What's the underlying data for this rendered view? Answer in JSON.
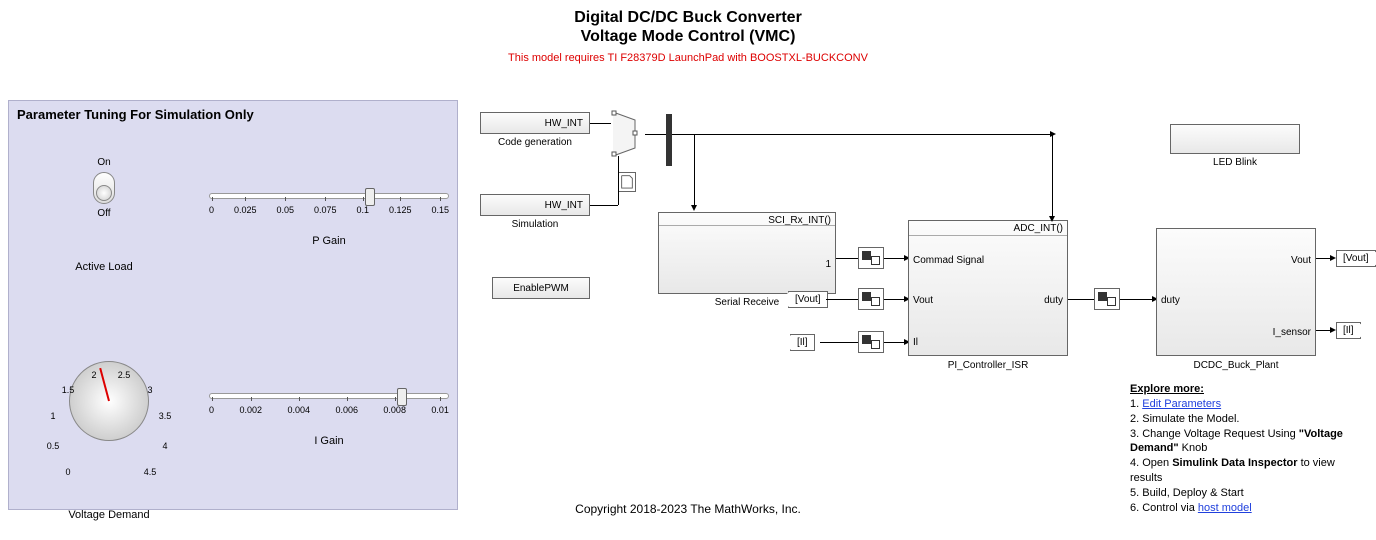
{
  "header": {
    "title1": "Digital DC/DC Buck Converter",
    "title2": "Voltage Mode Control (VMC)",
    "subtitle": "This model requires TI F28379D LaunchPad with BOOSTXL-BUCKCONV"
  },
  "copyright": "Copyright 2018-2023 The MathWorks, Inc.",
  "panel": {
    "title": "Parameter Tuning For Simulation Only",
    "active_load": {
      "label": "Active Load",
      "on": "On",
      "off": "Off",
      "state": "Off"
    },
    "p_gain": {
      "label": "P Gain",
      "ticks": [
        "0",
        "0.025",
        "0.05",
        "0.075",
        "0.1",
        "0.125",
        "0.15"
      ],
      "value": 0.1,
      "min": 0,
      "max": 0.15
    },
    "i_gain": {
      "label": "I Gain",
      "ticks": [
        "0",
        "0.002",
        "0.004",
        "0.006",
        "0.008",
        "0.01"
      ],
      "value": 0.008,
      "min": 0,
      "max": 0.01
    },
    "voltage_demand": {
      "label": "Voltage Demand",
      "ticks": [
        "0",
        "0.5",
        "1",
        "1.5",
        "2",
        "2.5",
        "3",
        "3.5",
        "4",
        "4.5"
      ],
      "value": 2,
      "min": 0,
      "max": 4.5
    }
  },
  "blocks": {
    "hw_int_1": "HW_INT",
    "hw_int_1_cap": "Code generation",
    "hw_int_2": "HW_INT",
    "hw_int_2_cap": "Simulation",
    "enable_pwm": "EnablePWM",
    "serial_rx_hdr": "SCI_Rx_INT()",
    "serial_rx_port": "1",
    "serial_rx_cap": "Serial Receive",
    "pi_hdr": "ADC_INT()",
    "pi_in1": "Commad Signal",
    "pi_in2": "Vout",
    "pi_in3": "Il",
    "pi_out": "duty",
    "pi_cap": "PI_Controller_ISR",
    "plant_in": "duty",
    "plant_out1": "Vout",
    "plant_out2": "I_sensor",
    "plant_cap": "DCDC_Buck_Plant",
    "led_cap": "LED Blink",
    "tag_vout": "[Vout]",
    "tag_il": "[Il]",
    "goto_vout": "[Vout]",
    "goto_il": "[Il]"
  },
  "explore": {
    "hd": "Explore more:",
    "l1a": "1. ",
    "l1b": "Edit Parameters",
    "l2": "2. Simulate the Model.",
    "l3a": "3. Change Voltage Request Using ",
    "l3b": "\"Voltage Demand\"",
    "l3c": " Knob",
    "l4a": "4. Open ",
    "l4b": "Simulink Data Inspector",
    "l4c": " to view results",
    "l5": "5. Build, Deploy & Start",
    "l6a": "6. Control via ",
    "l6b": "host model"
  }
}
